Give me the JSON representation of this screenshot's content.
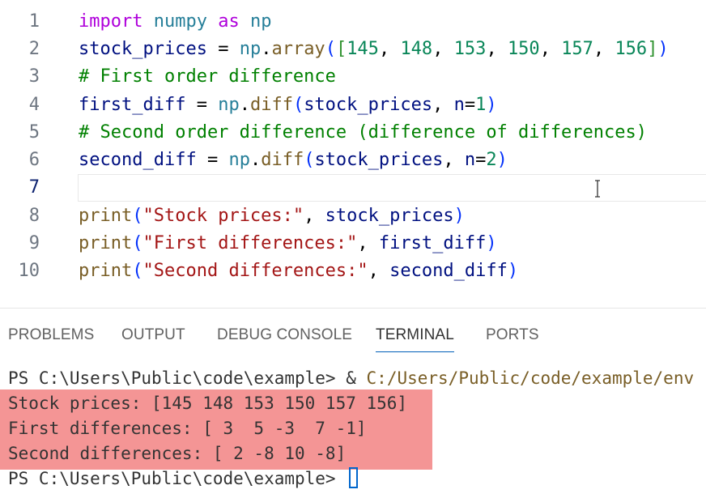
{
  "editor": {
    "lines": [
      {
        "num": "1"
      },
      {
        "num": "2"
      },
      {
        "num": "3"
      },
      {
        "num": "4"
      },
      {
        "num": "5"
      },
      {
        "num": "6"
      },
      {
        "num": "7"
      },
      {
        "num": "8"
      },
      {
        "num": "9"
      },
      {
        "num": "10"
      }
    ],
    "tokens": {
      "l1_import": "import",
      "l1_numpy": "numpy",
      "l1_as": "as",
      "l1_np": "np",
      "l2_var": "stock_prices",
      "l2_eq": "=",
      "l2_np": "np",
      "l2_dot": ".",
      "l2_array": "array",
      "l2_open": "(",
      "l2_bopen": "[",
      "l2_vals": [
        "145",
        "148",
        "153",
        "150",
        "157",
        "156"
      ],
      "l2_bclose": "]",
      "l2_close": ")",
      "l3_comment": "# First order difference",
      "l4_var": "first_diff",
      "l4_np": "np",
      "l4_diff": "diff",
      "l4_arg": "stock_prices",
      "l4_n": "n",
      "l4_val": "1",
      "l5_comment": "# Second order difference (difference of differences)",
      "l6_var": "second_diff",
      "l6_np": "np",
      "l6_diff": "diff",
      "l6_arg": "stock_prices",
      "l6_n": "n",
      "l6_val": "2",
      "l8_print": "print",
      "l8_str": "\"Stock prices:\"",
      "l8_arg": "stock_prices",
      "l9_print": "print",
      "l9_str": "\"First differences:\"",
      "l9_arg": "first_diff",
      "l10_print": "print",
      "l10_str": "\"Second differences:\"",
      "l10_arg": "second_diff"
    }
  },
  "panel": {
    "tabs": [
      {
        "label": "PROBLEMS"
      },
      {
        "label": "OUTPUT"
      },
      {
        "label": "DEBUG CONSOLE"
      },
      {
        "label": "TERMINAL",
        "active": true
      },
      {
        "label": "PORTS"
      }
    ],
    "terminal": {
      "prompt1": "PS C:\\Users\\Public\\code\\example> ",
      "cmd_amp": "& ",
      "cmd_path": "C:/Users/Public/code/example/env",
      "out1": "Stock prices: [145 148 153 150 157 156]",
      "out2": "First differences: [ 3  5 -3  7 -1]",
      "out3": "Second differences: [ 2 -8 10 -8]",
      "prompt2": "PS C:\\Users\\Public\\code\\example> "
    }
  },
  "colors": {
    "accent": "#005fb8",
    "highlight": "#f49595",
    "keyword": "#af00db",
    "variable": "#001080",
    "comment": "#008000",
    "number": "#098658",
    "string": "#a31515",
    "function": "#795e26"
  }
}
